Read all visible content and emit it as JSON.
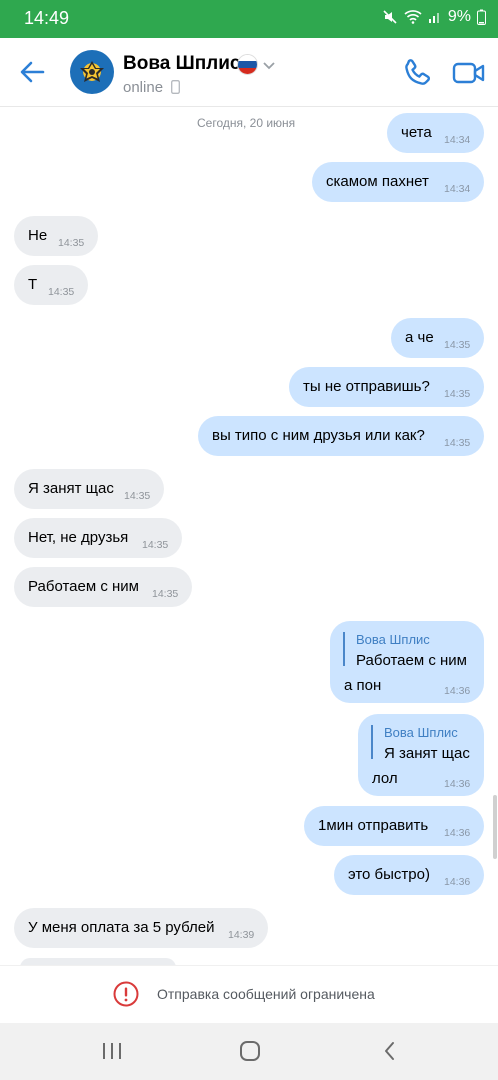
{
  "status_bar": {
    "time": "14:49",
    "battery": "9%",
    "bg_color": "#2fa84f"
  },
  "header": {
    "contact_name": "Вова Шплис",
    "status": "online",
    "icons": [
      "back-arrow-icon",
      "avatar",
      "russia-flag-icon",
      "chevron-down-icon",
      "mobile-device-icon",
      "phone-icon",
      "video-camera-icon"
    ],
    "accent_color": "#2c7fd6"
  },
  "chat": {
    "date_separator": "Сегодня, 20 июня",
    "messages": [
      {
        "dir": "out",
        "text": "чета",
        "time": "14:34"
      },
      {
        "dir": "out",
        "text": "скамом пахнет",
        "time": "14:34"
      },
      {
        "dir": "in",
        "text": "Не",
        "time": "14:35"
      },
      {
        "dir": "in",
        "text": "Т",
        "time": "14:35"
      },
      {
        "dir": "out",
        "text": "а че",
        "time": "14:35"
      },
      {
        "dir": "out",
        "text": "ты не отправишь?",
        "time": "14:35"
      },
      {
        "dir": "out",
        "text": "вы типо с ним друзья или как?",
        "time": "14:35"
      },
      {
        "dir": "in",
        "text": "Я занят щас",
        "time": "14:35"
      },
      {
        "dir": "in",
        "text": "Нет, не друзья",
        "time": "14:35"
      },
      {
        "dir": "in",
        "text": "Работаем с ним",
        "time": "14:35"
      },
      {
        "dir": "out",
        "reply_name": "Вова Шплис",
        "reply_text": "Работаем с ним",
        "text": "а пон",
        "time": "14:36"
      },
      {
        "dir": "out",
        "reply_name": "Вова Шплис",
        "reply_text": "Я занят щас",
        "text": "лол",
        "time": "14:36"
      },
      {
        "dir": "out",
        "text": "1мин отправить",
        "time": "14:36"
      },
      {
        "dir": "out",
        "text": "это быстро)",
        "time": "14:36"
      },
      {
        "dir": "in",
        "text": "У меня оплата за 5 рублей",
        "time": "14:39"
      }
    ],
    "incoming_color": "#ebedf0",
    "outgoing_color": "#cce4ff"
  },
  "footer": {
    "restricted_text": "Отправка сообщений ограничена",
    "warning_color": "#d93a3a"
  },
  "nav_bar": {
    "buttons": [
      "recent-apps-icon",
      "home-icon",
      "back-icon"
    ]
  }
}
